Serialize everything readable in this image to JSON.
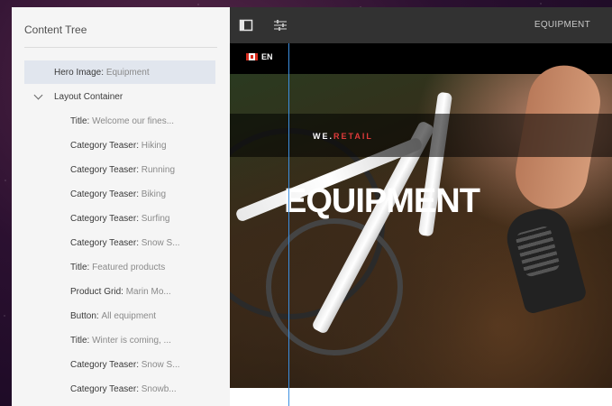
{
  "content_tree": {
    "title": "Content Tree",
    "items": [
      {
        "type": "Hero Image",
        "value": "Equipment",
        "level": 0,
        "selected": true
      },
      {
        "type": "Layout Container",
        "value": "",
        "level": 0,
        "expanded": true
      },
      {
        "type": "Title",
        "value": "Welcome our fines...",
        "level": 1
      },
      {
        "type": "Category Teaser",
        "value": "Hiking",
        "level": 1
      },
      {
        "type": "Category Teaser",
        "value": "Running",
        "level": 1
      },
      {
        "type": "Category Teaser",
        "value": "Biking",
        "level": 1
      },
      {
        "type": "Category Teaser",
        "value": "Surfing",
        "level": 1
      },
      {
        "type": "Category Teaser",
        "value": "Snow S...",
        "level": 1
      },
      {
        "type": "Title",
        "value": "Featured products",
        "level": 1
      },
      {
        "type": "Product Grid",
        "value": "Marin Mo...",
        "level": 1
      },
      {
        "type": "Button",
        "value": "All equipment",
        "level": 1
      },
      {
        "type": "Title",
        "value": "Winter is coming, ...",
        "level": 1
      },
      {
        "type": "Category Teaser",
        "value": "Snow S...",
        "level": 1
      },
      {
        "type": "Category Teaser",
        "value": "Snowb...",
        "level": 1
      }
    ]
  },
  "toolbar": {
    "page_label": "EQUIPMENT",
    "icons": [
      "side-panel-icon",
      "properties-icon"
    ]
  },
  "page": {
    "language": "EN",
    "brand_prefix": "WE.",
    "brand_suffix": "RETAIL",
    "hero_title": "EQUIPMENT",
    "accent_color": "#e03a3a"
  }
}
